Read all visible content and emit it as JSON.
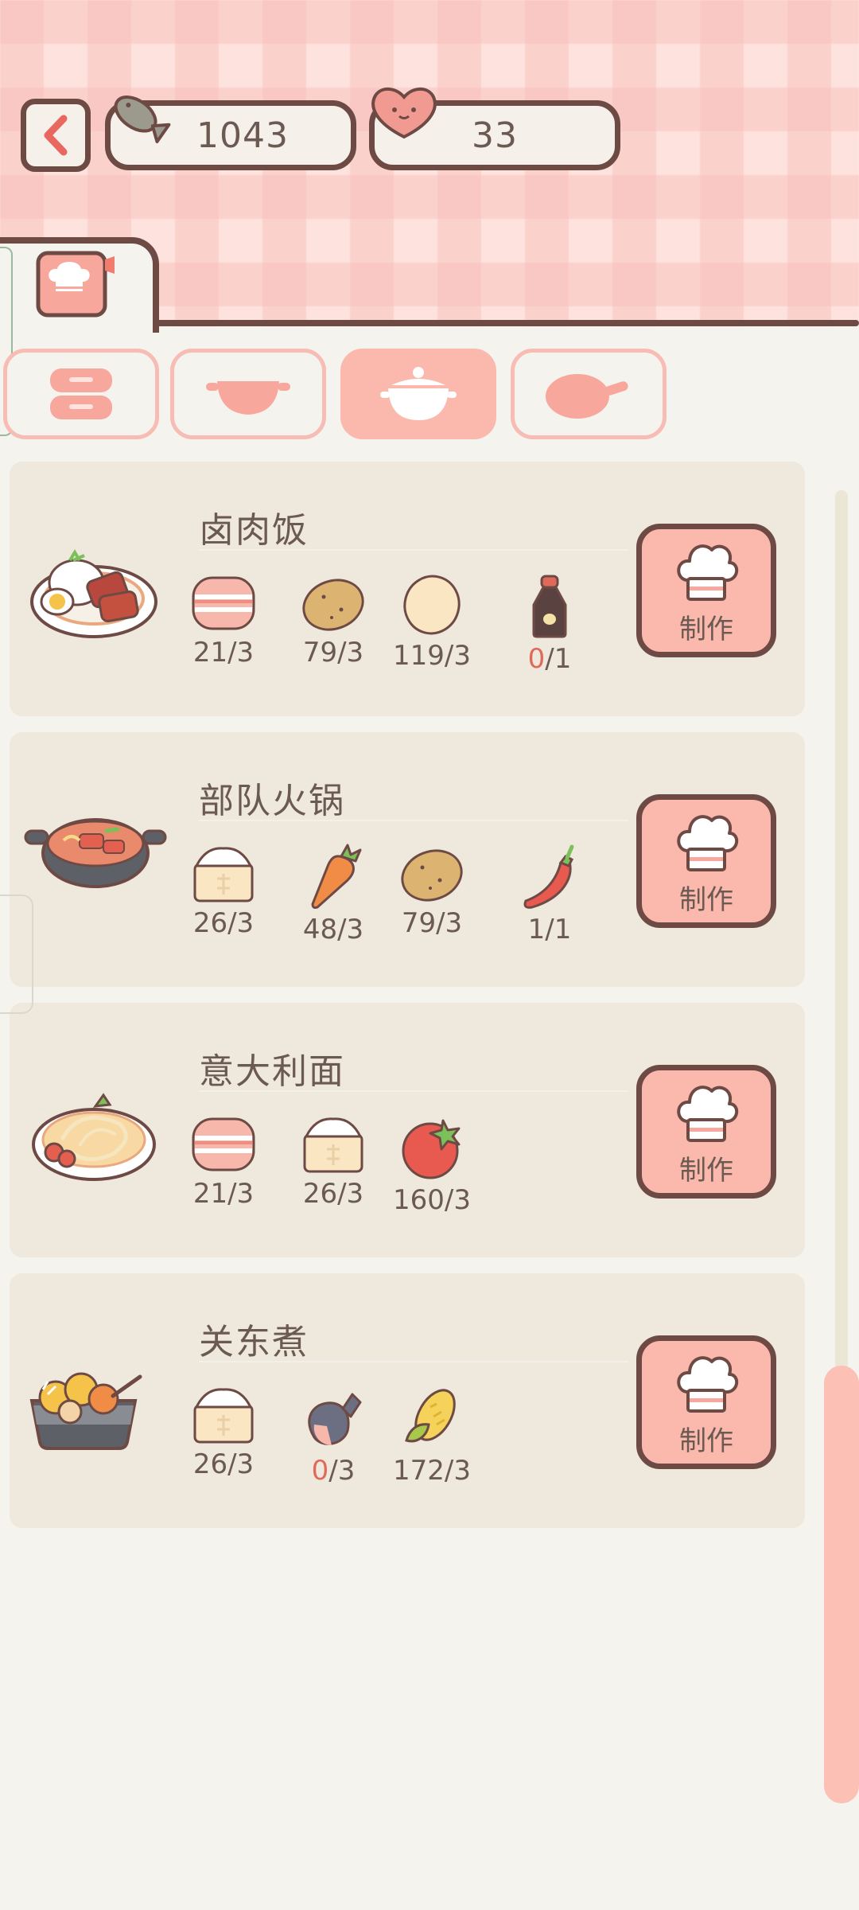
{
  "header": {
    "fish_count": "1043",
    "heart_count": "33"
  },
  "icons": {
    "back": "back-arrow-icon",
    "fish": "fish-currency-icon",
    "heart": "heart-currency-icon",
    "chef": "chef-book-icon"
  },
  "category_tabs": [
    {
      "name": "rice-cooker-icon",
      "active": false
    },
    {
      "name": "wok-icon",
      "active": false
    },
    {
      "name": "stew-pot-icon",
      "active": true
    },
    {
      "name": "frying-pan-icon",
      "active": false
    }
  ],
  "make_label": "制作",
  "recipes": [
    {
      "title": "卤肉饭",
      "dish_icon": "braised-pork-rice-icon",
      "ingredients": [
        {
          "icon": "meat-icon",
          "have": "21",
          "need": "/3",
          "short": false
        },
        {
          "icon": "potato-icon",
          "have": "79",
          "need": "/3",
          "short": false
        },
        {
          "icon": "egg-icon",
          "have": "119",
          "need": "/3",
          "short": false
        },
        {
          "icon": "soy-sauce-icon",
          "have": "0",
          "need": "/1",
          "short": true
        }
      ]
    },
    {
      "title": "部队火锅",
      "dish_icon": "army-hotpot-icon",
      "ingredients": [
        {
          "icon": "flour-icon",
          "have": "26",
          "need": "/3",
          "short": false
        },
        {
          "icon": "carrot-icon",
          "have": "48",
          "need": "/3",
          "short": false
        },
        {
          "icon": "potato-icon",
          "have": "79",
          "need": "/3",
          "short": false
        },
        {
          "icon": "chili-icon",
          "have": "1",
          "need": "/1",
          "short": false
        }
      ]
    },
    {
      "title": "意大利面",
      "dish_icon": "spaghetti-icon",
      "ingredients": [
        {
          "icon": "meat-icon",
          "have": "21",
          "need": "/3",
          "short": false
        },
        {
          "icon": "flour-icon",
          "have": "26",
          "need": "/3",
          "short": false
        },
        {
          "icon": "tomato-icon",
          "have": "160",
          "need": "/3",
          "short": false
        }
      ]
    },
    {
      "title": "关东煮",
      "dish_icon": "oden-icon",
      "ingredients": [
        {
          "icon": "flour-icon",
          "have": "26",
          "need": "/3",
          "short": false
        },
        {
          "icon": "fish-icon",
          "have": "0",
          "need": "/3",
          "short": true
        },
        {
          "icon": "corn-icon",
          "have": "172",
          "need": "/3",
          "short": false
        }
      ]
    }
  ],
  "colors": {
    "accent": "#fbb8ad",
    "outline": "#6e4a45",
    "card": "#efe8dd",
    "short": "#e06a5a"
  }
}
